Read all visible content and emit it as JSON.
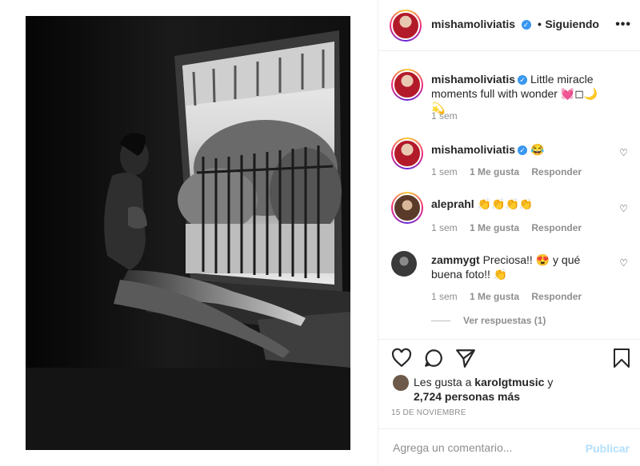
{
  "post": {
    "username": "mishamoliviatis",
    "follow_dot": "•",
    "follow_label": "Siguiendo",
    "more_icon": "more-horizontal-icon",
    "image_alt": "Foto en blanco y negro de una mujer sentada junto a una ventana con rejas"
  },
  "comments": [
    {
      "username": "mishamoliviatis",
      "verified": true,
      "text": "Little miracle moments full with wonder 💓◻🌙 💫",
      "time": "1 sem",
      "likes": "",
      "reply": ""
    },
    {
      "username": "mishamoliviatis",
      "verified": true,
      "text": "😂",
      "time": "1 sem",
      "likes": "1 Me gusta",
      "reply": "Responder"
    },
    {
      "username": "aleprahl",
      "verified": false,
      "text": "👏👏👏👏",
      "time": "1 sem",
      "likes": "1 Me gusta",
      "reply": "Responder"
    },
    {
      "username": "zammygt",
      "verified": false,
      "text": "Preciosa!! 😍 y qué buena foto!! 👏",
      "time": "1 sem",
      "likes": "1 Me gusta",
      "reply": "Responder"
    }
  ],
  "view_replies": "Ver respuestas (1)",
  "likes": {
    "prefix": "Les gusta a",
    "user": "karolgtmusic",
    "conj": "y",
    "count": "2,724 personas más"
  },
  "date": "15 DE NOVIEMBRE",
  "composer": {
    "placeholder": "Agrega un comentario...",
    "post_label": "Publicar"
  },
  "colors": {
    "accent": "#3897f0",
    "post_disabled": "#b2dffc",
    "muted": "#8e8e8e"
  }
}
